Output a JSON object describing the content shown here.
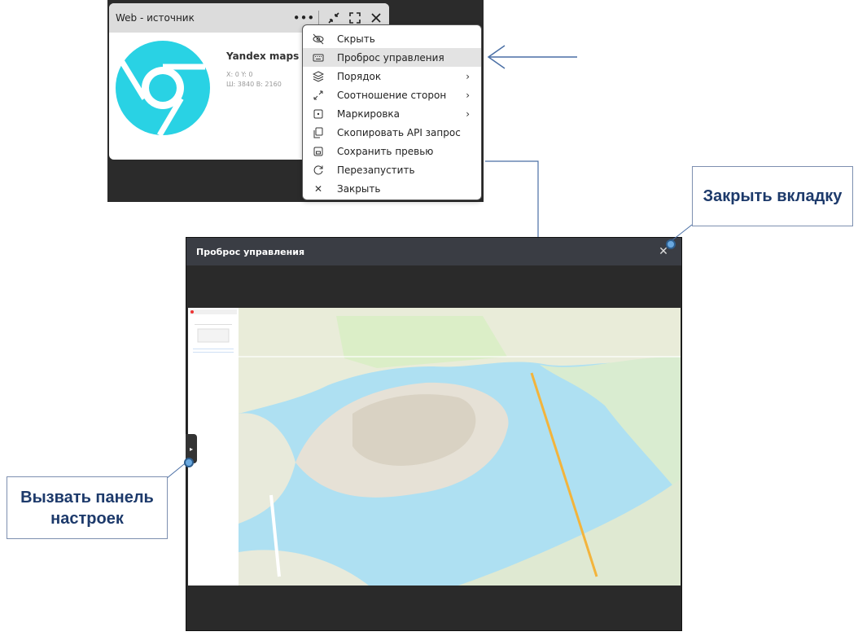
{
  "source_card": {
    "title": "Web - источник",
    "source_name": "Yandex maps 1",
    "coords_line1": "X: 0 Y: 0",
    "coords_line2": "Ш: 3840 В: 2160",
    "icons": [
      "more-icon",
      "minimize-icon",
      "fullscreen-icon",
      "close-icon"
    ]
  },
  "context_menu": {
    "items": [
      {
        "label": "Скрыть",
        "icon": "eye-off-icon",
        "submenu": false
      },
      {
        "label": "Проброс управления",
        "icon": "keyboard-icon",
        "submenu": false,
        "active": true
      },
      {
        "label": "Порядок",
        "icon": "layers-icon",
        "submenu": true
      },
      {
        "label": "Соотношение сторон",
        "icon": "expand-icon",
        "submenu": true
      },
      {
        "label": "Маркировка",
        "icon": "marker-icon",
        "submenu": true
      },
      {
        "label": "Скопировать API запрос",
        "icon": "copy-icon",
        "submenu": false
      },
      {
        "label": "Сохранить превью",
        "icon": "save-icon",
        "submenu": false
      },
      {
        "label": "Перезапустить",
        "icon": "restart-icon",
        "submenu": false
      },
      {
        "label": "Закрыть",
        "icon": "close-icon",
        "submenu": false
      }
    ]
  },
  "remote_window": {
    "title": "Проброс управления"
  },
  "callouts": {
    "close_tab": "Закрыть вкладку",
    "settings_line1": "Вызвать панель",
    "settings_line2": "настроек"
  },
  "colors": {
    "accent": "#1d3a6b",
    "chrome_cyan": "#29d2e4",
    "callout_line": "#4a6fa5"
  }
}
